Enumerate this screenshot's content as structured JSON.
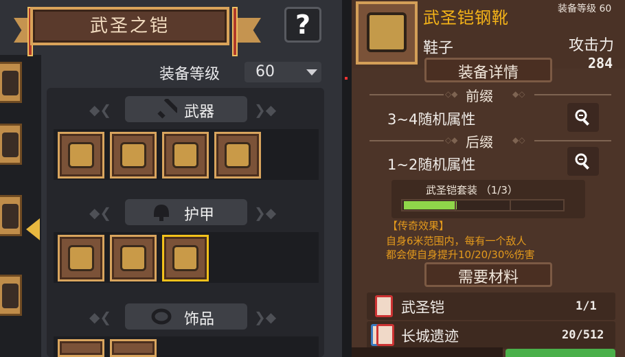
{
  "left": {
    "title": "武圣之铠",
    "help": "?",
    "level_label": "装备等级",
    "level_value": "60",
    "categories": [
      {
        "label": "武器",
        "icon": "sword-icon"
      },
      {
        "label": "护甲",
        "icon": "helmet-icon"
      },
      {
        "label": "饰品",
        "icon": "ring-icon"
      }
    ]
  },
  "right": {
    "equip_name": "武圣铠钢靴",
    "equip_level": "装备等级 60",
    "equip_type": "鞋子",
    "attack_label": "攻击力",
    "attack_value": "284",
    "details_title": "装备详情",
    "prefix_label": "前缀",
    "prefix_text": "3~4随机属性",
    "suffix_label": "后缀",
    "suffix_text": "1~2随机属性",
    "set_name": "武圣铠套装 （1/3）",
    "set_progress": 0.333,
    "legend_title": "【传奇效果】",
    "legend_line1": "自身6米范围内，每有一个敌人",
    "legend_line2": "都会使自身提升10/20/30%伤害",
    "materials_title": "需要材料",
    "materials": [
      {
        "name": "武圣铠",
        "count": "1/1"
      },
      {
        "name": "长城遗迹",
        "count": "20/512"
      }
    ]
  },
  "colors": {
    "accent_gold": "#f5b418",
    "legend_orange": "#e49a1c",
    "progress_green": "#8fd64a",
    "selection_yellow": "#f3c21b"
  }
}
